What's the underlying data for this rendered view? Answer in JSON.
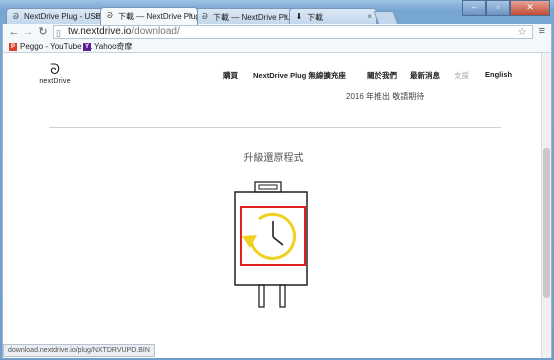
{
  "browser": {
    "tabs": [
      {
        "title": "NextDrive Plug - USB W",
        "icon": "nextdrive-logo-icon"
      },
      {
        "title": "下載 — NextDrive Plug -",
        "icon": "nextdrive-logo-icon",
        "active": true
      },
      {
        "title": "下載 — NextDrive Plug -",
        "icon": "nextdrive-logo-icon"
      },
      {
        "title": "下載",
        "icon": "download-icon"
      }
    ],
    "url_host": "tw.nextdrive.io",
    "url_path": "/download/",
    "bookmarks": [
      {
        "label": "Peggo - YouTube t...",
        "icon": "peggo-icon",
        "color": "#d9412b"
      },
      {
        "label": "Yahoo奇摩",
        "icon": "yahoo-icon",
        "color": "#5d1c94"
      }
    ],
    "status_text": "download.nextdrive.io/plug/NXTDRVUPD.BIN"
  },
  "site": {
    "logo_text": "nextDrive",
    "nav": [
      "購買",
      "NextDrive Plug 無線擴充座",
      "關於我們",
      "最新消息",
      "支援",
      "English"
    ],
    "news_fragment": "2016 年推出 敬請期待"
  },
  "main": {
    "section_title": "升級還原程式",
    "icon": "device-restore-icon",
    "highlight_color": "#e02020",
    "clock_color": "#f0d020"
  }
}
